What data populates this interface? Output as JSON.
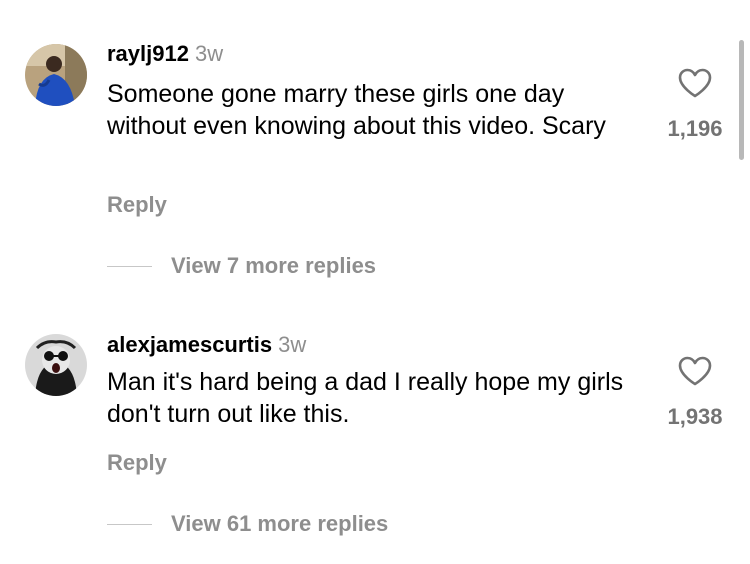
{
  "comments": [
    {
      "username": "raylj912",
      "time": "3w",
      "text": "Someone gone marry these girls one day without even knowing about this video. Scary",
      "reply_label": "Reply",
      "view_replies": "View 7 more replies",
      "likes": "1,196",
      "avatar_icon": "user-avatar-photo"
    },
    {
      "username": "alexjamescurtis",
      "time": "3w",
      "text": "Man it's hard being a dad I really hope my girls don't turn out like this.",
      "reply_label": "Reply",
      "view_replies": "View 61 more replies",
      "likes": "1,938",
      "avatar_icon": "user-avatar-photo"
    }
  ],
  "icons": {
    "like": "heart-outline-icon"
  },
  "colors": {
    "secondary_text": "#8e8e8e",
    "count_text": "#737373",
    "primary_text": "#000000"
  }
}
